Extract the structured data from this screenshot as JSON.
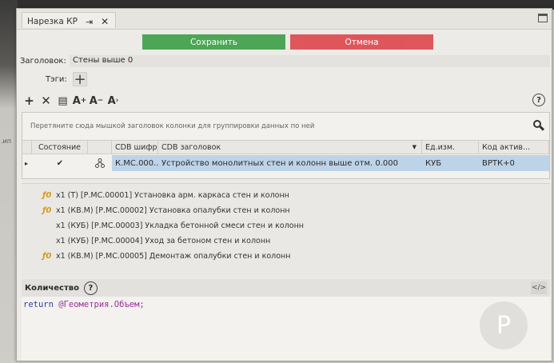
{
  "window": {
    "title": "Нарезка КР"
  },
  "actions": {
    "save_label": "Сохранить",
    "cancel_label": "Отмена"
  },
  "header": {
    "label": "Заголовок:",
    "value": "Стены выше 0"
  },
  "tags": {
    "label": "Тэги:"
  },
  "toolbar": [
    "add-icon",
    "delete-icon",
    "list-icon",
    "font-increase-icon",
    "font-decrease-icon",
    "font-reset-icon"
  ],
  "grid": {
    "group_hint": "Перетяните сюда мышкой заголовок колонки для группировки данных по ней",
    "columns": [
      "Состояние",
      "CDB шифр",
      "CDB заголовок",
      "Ед.изм.",
      "Код актив..."
    ],
    "rows": [
      {
        "indicator": "▸",
        "state": "✔",
        "code": "К.МС.000...",
        "title": "Устройство монолитных стен и колонн выше отм. 0.000",
        "unit": "КУБ",
        "activity": "ВРТК+0"
      }
    ]
  },
  "works": [
    {
      "fx": true,
      "text": "x1 (Т) [Р.МС.00001] Установка арм. каркаса стен и колонн"
    },
    {
      "fx": true,
      "text": "x1 (КВ.М) [Р.МС.00002] Установка опалубки стен и колонн"
    },
    {
      "fx": false,
      "text": "x1 (КУБ) [Р.МС.00003] Укладка бетонной смеси стен и колонн"
    },
    {
      "fx": false,
      "text": "x1 (КУБ) [Р.МС.00004] Уход за бетоном стен и колонн"
    },
    {
      "fx": true,
      "text": "x1 (КВ.М) [Р.МС.00005] Демонтаж опалубки стен и колонн"
    }
  ],
  "quantity": {
    "label": "Количество",
    "code_keyword": "return",
    "code_expression": "@Геометрия.Объем;"
  },
  "colors": {
    "save": "#3fa14a",
    "cancel": "#de4a4f",
    "selected_row": "#bdd3e8",
    "fx": "#d89a1a"
  }
}
